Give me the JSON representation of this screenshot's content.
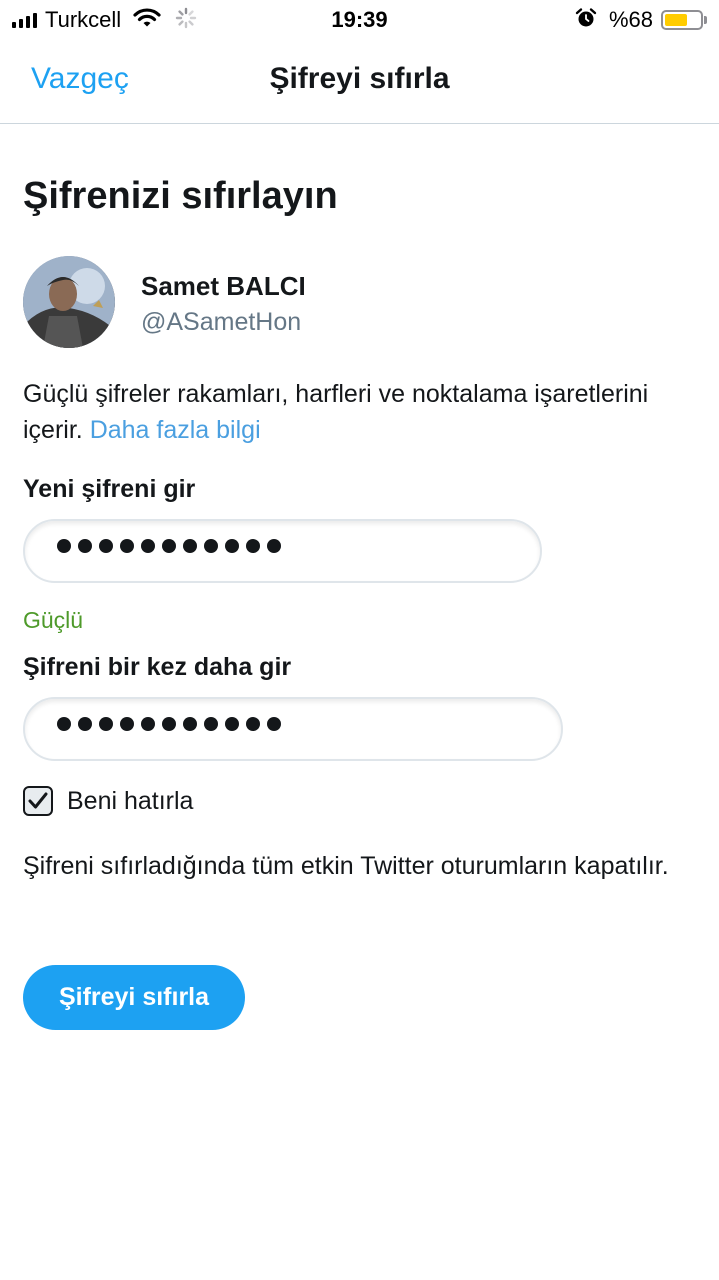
{
  "status_bar": {
    "carrier": "Turkcell",
    "time": "19:39",
    "battery_percent": "%68",
    "battery_level": 0.68,
    "battery_color": "#ffcc00",
    "icons": [
      "signal-icon",
      "wifi-icon",
      "activity-spinner-icon",
      "alarm-icon",
      "battery-icon"
    ]
  },
  "nav": {
    "cancel_label": "Vazgeç",
    "title": "Şifreyi sıfırla"
  },
  "page": {
    "heading": "Şifrenizi sıfırlayın"
  },
  "user": {
    "name": "Samet BALCI",
    "handle": "@ASametHon"
  },
  "info": {
    "text": "Güçlü şifreler rakamları, harfleri ve noktalama işaretlerini içerir.",
    "link": "Daha fazla bilgi"
  },
  "form": {
    "new_password_label": "Yeni şifreni gir",
    "new_password_length": 11,
    "strength_label": "Güçlü",
    "strength_color": "#4e9a2a",
    "confirm_password_label": "Şifreni bir kez daha gir",
    "confirm_password_length": 11,
    "remember_label": "Beni hatırla",
    "remember_checked": true
  },
  "notice": "Şifreni sıfırladığında tüm etkin Twitter oturumların kapatılır.",
  "submit_label": "Şifreyi sıfırla",
  "colors": {
    "accent": "#1da1f2",
    "link": "#4a9fe0"
  }
}
